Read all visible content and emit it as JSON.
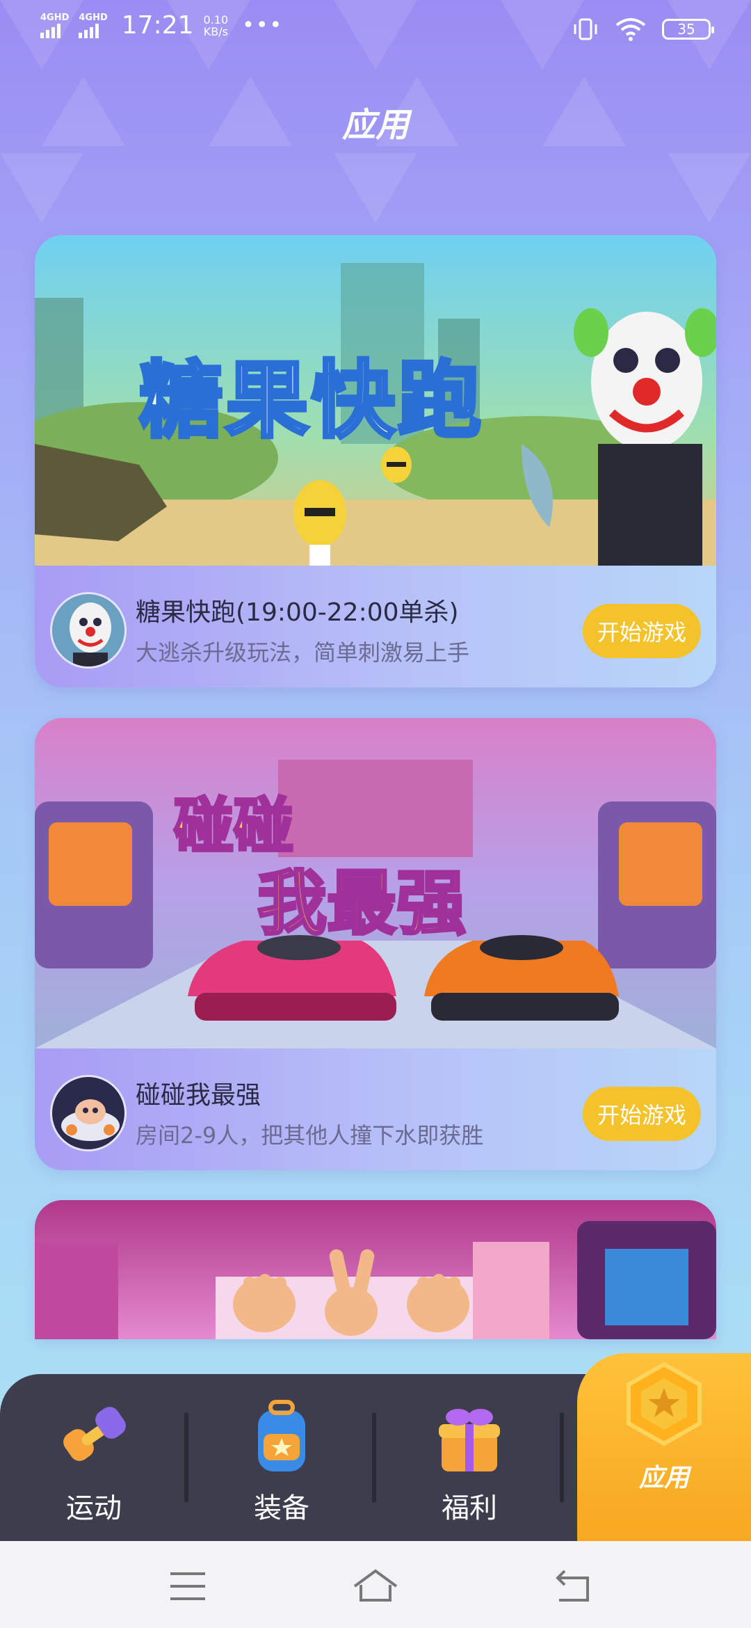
{
  "status_bar": {
    "network_1": "4GHD",
    "network_2": "4GHD",
    "time": "17:21",
    "speed_value": "0.10",
    "speed_unit": "KB/s",
    "more": "•••",
    "battery": "35"
  },
  "page": {
    "title": "应用"
  },
  "games": [
    {
      "banner_title": "糖果快跑",
      "name": "糖果快跑(19:00-22:00单杀)",
      "description": "大逃杀升级玩法，简单刺激易上手",
      "button": "开始游戏"
    },
    {
      "banner_title_line1": "碰碰",
      "banner_title_line2": "我最强",
      "name": "碰碰我最强",
      "description": "房间2-9人，把其他人撞下水即获胜",
      "button": "开始游戏"
    }
  ],
  "bottom_nav": {
    "items": [
      {
        "label": "运动",
        "icon": "dumbbell-icon"
      },
      {
        "label": "装备",
        "icon": "backpack-icon"
      },
      {
        "label": "福利",
        "icon": "gift-icon"
      }
    ],
    "active": {
      "label": "应用",
      "icon": "star-coin-icon"
    }
  },
  "colors": {
    "accent": "#f4c22a",
    "nav_bg": "#3d3d4e",
    "active_tab": "#f7a51f"
  }
}
